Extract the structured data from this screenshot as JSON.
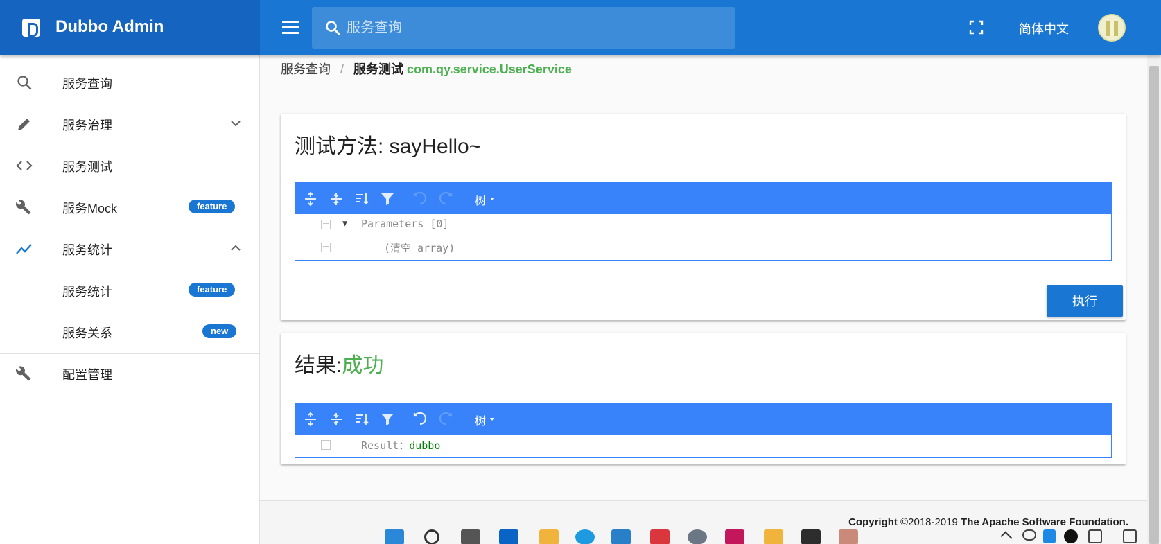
{
  "header": {
    "brand_title": "Dubbo Admin",
    "search_placeholder": "服务查询",
    "language": "简体中文",
    "colors": {
      "bar": "#1976d2",
      "brand": "#1565c0"
    }
  },
  "sidebar": {
    "items": [
      {
        "label": "服务查询",
        "icon": "search-icon"
      },
      {
        "label": "服务治理",
        "icon": "pencil-icon",
        "chevron": "down"
      },
      {
        "label": "服务测试",
        "icon": "code-icon"
      },
      {
        "label": "服务Mock",
        "icon": "wrench-icon",
        "badge": "feature"
      },
      {
        "label": "服务统计",
        "icon": "trending-up-icon",
        "chevron": "up"
      },
      {
        "label": "服务统计",
        "badge": "feature"
      },
      {
        "label": "服务关系",
        "badge": "new"
      },
      {
        "label": "配置管理",
        "icon": "wrench-icon"
      }
    ]
  },
  "breadcrumb": {
    "root": "服务查询",
    "separator": "/",
    "current": "服务测试",
    "service": "com.qy.service.UserService"
  },
  "test_card": {
    "title": "测试方法: sayHello~",
    "editor": {
      "mode_label": "树",
      "rows": [
        {
          "key": "Parameters",
          "value": "[0]"
        },
        {
          "value": "(清空 array)"
        }
      ]
    },
    "execute_label": "执行"
  },
  "result_card": {
    "title_prefix": "结果:",
    "status": "成功",
    "editor": {
      "mode_label": "树",
      "rows": [
        {
          "key": "Result",
          "sep": "：",
          "value": "dubbo"
        }
      ]
    }
  },
  "footer": {
    "copyright_label": "Copyright",
    "years": "©2018-2019",
    "org": "The Apache Software Foundation."
  }
}
